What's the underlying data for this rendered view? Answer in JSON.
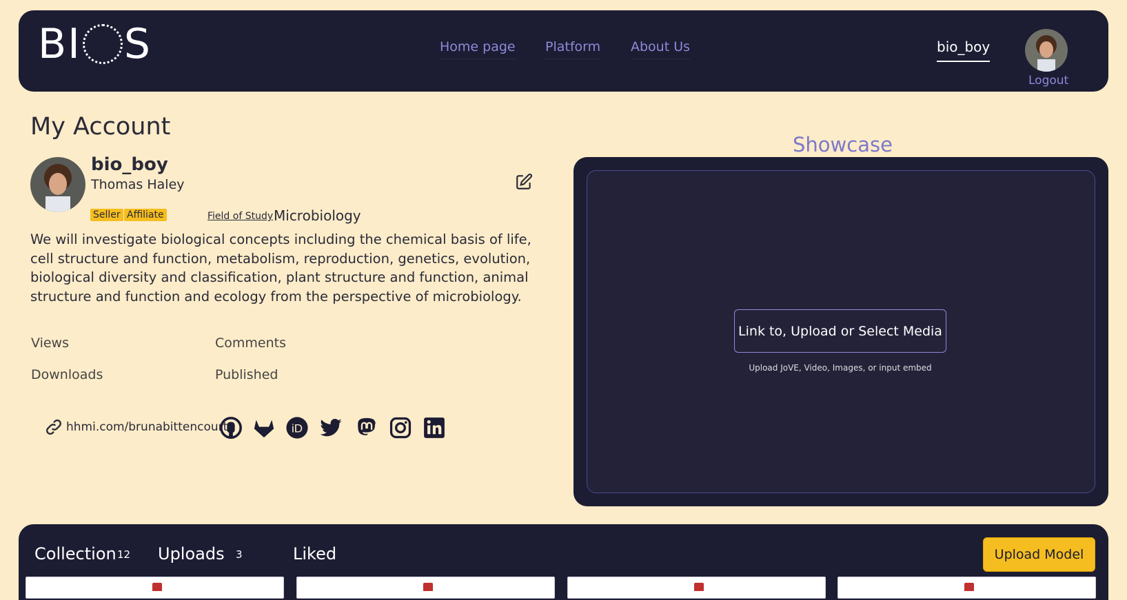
{
  "header": {
    "logo_text_left": "BI",
    "logo_text_right": "S",
    "nav": [
      "Home page",
      "Platform",
      "About Us"
    ],
    "username": "bio_boy",
    "logout": "Logout"
  },
  "account": {
    "page_title": "My Account",
    "handle": "bio_boy",
    "name": "Thomas Haley",
    "badges": [
      "Seller",
      "Affiliate"
    ],
    "field_of_study_label": "Field of Study",
    "field_of_study": "Microbiology",
    "bio": "We will investigate biological concepts including the chemical basis of life, cell structure and function, metabolism, reproduction, genetics, evolution, biological diversity and classification, plant structure and function, animal structure and function and ecology from the perspective of microbiology.",
    "stats": [
      "Views",
      "Comments",
      "Downloads",
      "Published"
    ],
    "link": "hhmi.com/brunabittencourt",
    "social_icons": [
      "github-icon",
      "gitlab-icon",
      "orcid-icon",
      "twitter-icon",
      "mastodon-icon",
      "instagram-icon",
      "linkedin-icon"
    ]
  },
  "showcase": {
    "title": "Showcase",
    "button": "Link to, Upload or Select Media",
    "hint": "Upload JoVE, Video, Images, or input embed"
  },
  "library": {
    "tabs": [
      {
        "label": "Collection",
        "count": "12"
      },
      {
        "label": "Uploads",
        "count": "3"
      },
      {
        "label": "Liked",
        "count": ""
      }
    ],
    "upload_button": "Upload Model"
  },
  "colors": {
    "background": "#fdecc9",
    "panel": "#1c1c33",
    "accent": "#8d8ad9",
    "highlight": "#f5bd1f"
  }
}
